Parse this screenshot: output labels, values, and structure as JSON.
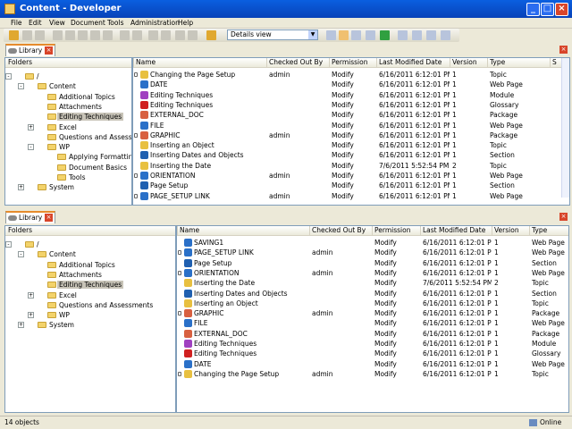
{
  "window": {
    "title": "Content - Developer"
  },
  "menu": [
    "File",
    "Edit",
    "View",
    "Document",
    "Tools",
    "Administration",
    "Help"
  ],
  "toolbar": {
    "view_select": "Details view"
  },
  "tabs": {
    "library": "Library"
  },
  "tree": {
    "header": "Folders"
  },
  "top_tree": [
    {
      "label": "/",
      "level": 0,
      "exp": "-"
    },
    {
      "label": "Content",
      "level": 1,
      "exp": "-"
    },
    {
      "label": "Additional Topics",
      "level": 2
    },
    {
      "label": "Attachments",
      "level": 2
    },
    {
      "label": "Editing Techniques",
      "level": 2,
      "selected": true
    },
    {
      "label": "Excel",
      "level": 2,
      "exp": "+"
    },
    {
      "label": "Questions and Assessments",
      "level": 2
    },
    {
      "label": "WP",
      "level": 2,
      "exp": "-"
    },
    {
      "label": "Applying Formatting",
      "level": 3
    },
    {
      "label": "Document Basics",
      "level": 3
    },
    {
      "label": "Tools",
      "level": 3
    },
    {
      "label": "System",
      "level": 1,
      "exp": "+"
    }
  ],
  "bottom_tree": [
    {
      "label": "/",
      "level": 0,
      "exp": "-"
    },
    {
      "label": "Content",
      "level": 1,
      "exp": "-"
    },
    {
      "label": "Additional Topics",
      "level": 2
    },
    {
      "label": "Attachments",
      "level": 2
    },
    {
      "label": "Editing Techniques",
      "level": 2,
      "selected": true
    },
    {
      "label": "Excel",
      "level": 2,
      "exp": "+"
    },
    {
      "label": "Questions and Assessments",
      "level": 2
    },
    {
      "label": "WP",
      "level": 2,
      "exp": "+"
    },
    {
      "label": "System",
      "level": 1,
      "exp": "+"
    }
  ],
  "columns": [
    "Name",
    "Checked Out By",
    "Permission",
    "Last Modified Date",
    "Version",
    "Type",
    "S"
  ],
  "top_rows": [
    [
      "Changing the Page Setup",
      "admin",
      "Modify",
      "6/16/2011 6:12:01 PM",
      "1",
      "Topic",
      "topic"
    ],
    [
      "DATE",
      "",
      "Modify",
      "6/16/2011 6:12:01 PM",
      "1",
      "Web Page",
      "web"
    ],
    [
      "Editing Techniques",
      "",
      "Modify",
      "6/16/2011 6:12:01 PM",
      "1",
      "Module",
      "module"
    ],
    [
      "Editing Techniques",
      "",
      "Modify",
      "6/16/2011 6:12:01 PM",
      "1",
      "Glossary",
      "glossary"
    ],
    [
      "EXTERNAL_DOC",
      "",
      "Modify",
      "6/16/2011 6:12:01 PM",
      "1",
      "Package",
      "package"
    ],
    [
      "FILE",
      "",
      "Modify",
      "6/16/2011 6:12:01 PM",
      "1",
      "Web Page",
      "web"
    ],
    [
      "GRAPHIC",
      "admin",
      "Modify",
      "6/16/2011 6:12:01 PM",
      "1",
      "Package",
      "package"
    ],
    [
      "Inserting an Object",
      "",
      "Modify",
      "6/16/2011 6:12:01 PM",
      "1",
      "Topic",
      "topic"
    ],
    [
      "Inserting Dates and Objects",
      "",
      "Modify",
      "6/16/2011 6:12:01 PM",
      "1",
      "Section",
      "section"
    ],
    [
      "Inserting the Date",
      "",
      "Modify",
      "7/6/2011 5:52:54 PM",
      "2",
      "Topic",
      "topic"
    ],
    [
      "ORIENTATION",
      "admin",
      "Modify",
      "6/16/2011 6:12:01 PM",
      "1",
      "Web Page",
      "web"
    ],
    [
      "Page Setup",
      "",
      "Modify",
      "6/16/2011 6:12:01 PM",
      "1",
      "Section",
      "section"
    ],
    [
      "PAGE_SETUP LINK",
      "admin",
      "Modify",
      "6/16/2011 6:12:01 PM",
      "1",
      "Web Page",
      "web"
    ]
  ],
  "bottom_rows": [
    [
      "SAVING1",
      "",
      "Modify",
      "6/16/2011 6:12:01 PM",
      "1",
      "Web Page",
      "web"
    ],
    [
      "PAGE_SETUP LINK",
      "admin",
      "Modify",
      "6/16/2011 6:12:01 PM",
      "1",
      "Web Page",
      "web"
    ],
    [
      "Page Setup",
      "",
      "Modify",
      "6/16/2011 6:12:01 PM",
      "1",
      "Section",
      "section"
    ],
    [
      "ORIENTATION",
      "admin",
      "Modify",
      "6/16/2011 6:12:01 PM",
      "1",
      "Web Page",
      "web"
    ],
    [
      "Inserting the Date",
      "",
      "Modify",
      "7/6/2011 5:52:54 PM",
      "2",
      "Topic",
      "topic"
    ],
    [
      "Inserting Dates and Objects",
      "",
      "Modify",
      "6/16/2011 6:12:01 PM",
      "1",
      "Section",
      "section"
    ],
    [
      "Inserting an Object",
      "",
      "Modify",
      "6/16/2011 6:12:01 PM",
      "1",
      "Topic",
      "topic"
    ],
    [
      "GRAPHIC",
      "admin",
      "Modify",
      "6/16/2011 6:12:01 PM",
      "1",
      "Package",
      "package"
    ],
    [
      "FILE",
      "",
      "Modify",
      "6/16/2011 6:12:01 PM",
      "1",
      "Web Page",
      "web"
    ],
    [
      "EXTERNAL_DOC",
      "",
      "Modify",
      "6/16/2011 6:12:01 PM",
      "1",
      "Package",
      "package"
    ],
    [
      "Editing Techniques",
      "",
      "Modify",
      "6/16/2011 6:12:01 PM",
      "1",
      "Module",
      "module"
    ],
    [
      "Editing Techniques",
      "",
      "Modify",
      "6/16/2011 6:12:01 PM",
      "1",
      "Glossary",
      "glossary"
    ],
    [
      "DATE",
      "",
      "Modify",
      "6/16/2011 6:12:01 PM",
      "1",
      "Web Page",
      "web"
    ],
    [
      "Changing the Page Setup",
      "admin",
      "Modify",
      "6/16/2011 6:12:01 PM",
      "1",
      "Topic",
      "topic"
    ]
  ],
  "icon_colors": {
    "topic": "#e8c040",
    "web": "#2a70c8",
    "module": "#a040c0",
    "glossary": "#d02020",
    "package": "#d86040",
    "section": "#2060b0"
  },
  "status": {
    "count": "14 objects",
    "connection": "Online"
  }
}
